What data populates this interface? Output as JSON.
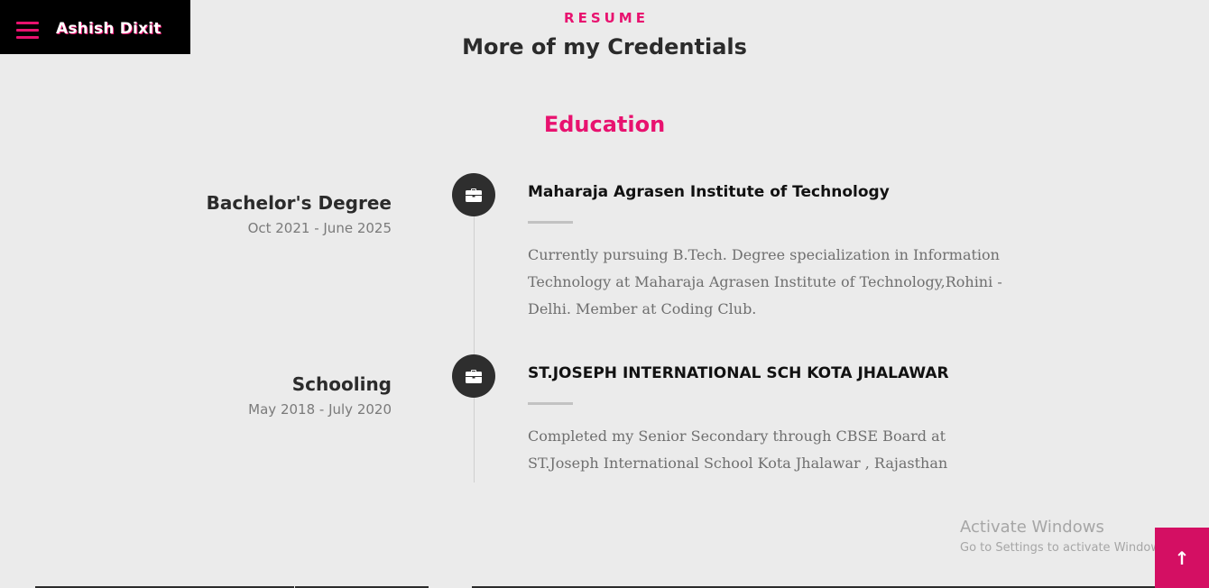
{
  "header": {
    "brand": "Ashish Dixit",
    "menu_icon": "hamburger-menu-icon"
  },
  "section": {
    "kicker": "RESUME",
    "title": "More of my Credentials",
    "sub_heading": "Education"
  },
  "education": [
    {
      "degree": "Bachelor's Degree",
      "dates": "Oct 2021 - June 2025",
      "icon": "briefcase-icon",
      "school": "Maharaja Agrasen Institute of Technology",
      "description": "Currently pursuing B.Tech. Degree specialization in Information Technology at Maharaja Agrasen Institute of Technology,Rohini - Delhi. Member at Coding Club."
    },
    {
      "degree": "Schooling",
      "dates": "May 2018 - July 2020",
      "icon": "briefcase-icon",
      "school": "ST.JOSEPH INTERNATIONAL SCH KOTA JHALAWAR",
      "description": "Completed my Senior Secondary through CBSE Board at ST.Joseph International School Kota Jhalawar , Rajasthan"
    }
  ],
  "watermark": {
    "title": "Activate Windows",
    "subtitle": "Go to Settings to activate Windows."
  },
  "back_to_top": {
    "label": "↑",
    "icon": "arrow-up-icon"
  },
  "colors": {
    "accent": "#e8126f",
    "background": "#ebebeb",
    "nav_background": "#000000",
    "icon_circle": "#2e2e2e",
    "to_top_button": "#d40f63"
  }
}
